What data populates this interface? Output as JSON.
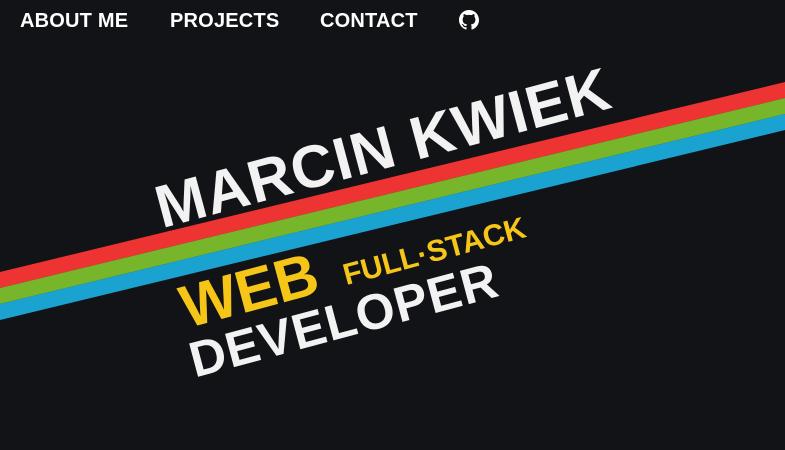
{
  "nav": {
    "items": [
      {
        "label": "ABOUT ME"
      },
      {
        "label": "PROJECTS"
      },
      {
        "label": "CONTACT"
      }
    ],
    "github_icon": "github-icon"
  },
  "hero": {
    "name": "MARCIN KWIEK",
    "role_word": "WEB",
    "role_prefix": "FULL·STACK",
    "role_title": "DEVELOPER"
  },
  "colors": {
    "background": "#121316",
    "text": "#f2f2f2",
    "accent": "#f5c518",
    "stripe_red": "#ee3333",
    "stripe_green": "#77b52a",
    "stripe_blue": "#1aa3d0"
  }
}
